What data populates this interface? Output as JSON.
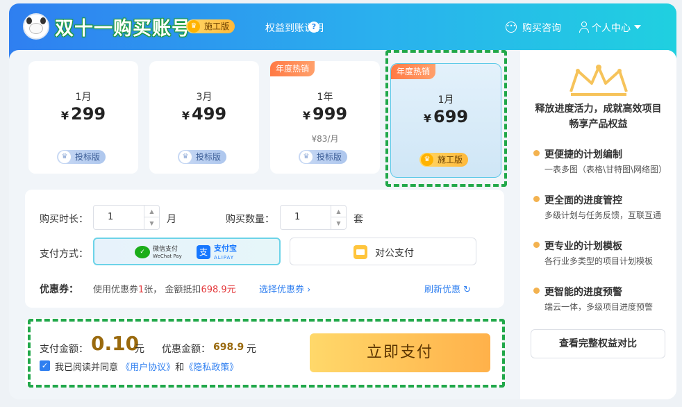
{
  "header": {
    "title": "双十一购买账号",
    "edition_badge": "施工版",
    "rights_link": "权益到账说明",
    "consult": "购买咨询",
    "user_center": "个人中心"
  },
  "plans": [
    {
      "duration": "1月",
      "currency": "¥",
      "price": "299",
      "per_month": "",
      "hot": "",
      "badge": "投标版"
    },
    {
      "duration": "3月",
      "currency": "¥",
      "price": "499",
      "per_month": "",
      "hot": "",
      "badge": "投标版"
    },
    {
      "duration": "1年",
      "currency": "¥",
      "price": "999",
      "per_month": "¥83/月",
      "hot": "年度热销",
      "badge": "投标版"
    },
    {
      "duration": "1月",
      "currency": "¥",
      "price": "699",
      "per_month": "",
      "hot": "年度热销",
      "badge": "施工版"
    }
  ],
  "form": {
    "duration_label": "购买时长：",
    "duration_value": "1",
    "duration_unit": "月",
    "quantity_label": "购买数量：",
    "quantity_value": "1",
    "quantity_unit": "套",
    "payment_label": "支付方式：",
    "wechat_cn": "微信支付",
    "wechat_en": "WeChat Pay",
    "alipay_cn": "支付宝",
    "alipay_en": "ALIPAY",
    "corporate": "对公支付",
    "coupon_label": "优惠券：",
    "coupon_prefix": "使用优惠券",
    "coupon_count": "1",
    "coupon_mid": "张， 金额抵扣",
    "coupon_amount": "698.9元",
    "select_coupon": "选择优惠券 ›",
    "refresh": "刷新优惠 ↻"
  },
  "payment": {
    "amount_label": "支付金额：",
    "amount": "0.10",
    "amount_unit": "元",
    "discount_label": "优惠金额：",
    "discount": "698.9",
    "discount_unit": "元",
    "agree_prefix": "我已阅读并同意",
    "agreement": "《用户协议》",
    "and": "和",
    "privacy": "《隐私政策》",
    "pay_button": "立即支付"
  },
  "side": {
    "title_line1": "释放进度活力，成就高效项目",
    "title_line2": "畅享产品权益",
    "features": [
      {
        "title": "更便捷的计划编制",
        "desc": "一表多图（表格\\甘特图\\网络图）"
      },
      {
        "title": "更全面的进度管控",
        "desc": "多级计划与任务反馈，互联互通"
      },
      {
        "title": "更专业的计划模板",
        "desc": "各行业多类型的项目计划模板"
      },
      {
        "title": "更智能的进度预警",
        "desc": "端云一体，多级项目进度预警"
      }
    ],
    "compare_button": "查看完整权益对比"
  },
  "colors": {
    "header_start": "#2f7ff0",
    "header_end": "#20d0e0",
    "gold": "#ffb93a",
    "highlight_dash": "#21a84a",
    "price_gold": "#9a6a0e"
  }
}
